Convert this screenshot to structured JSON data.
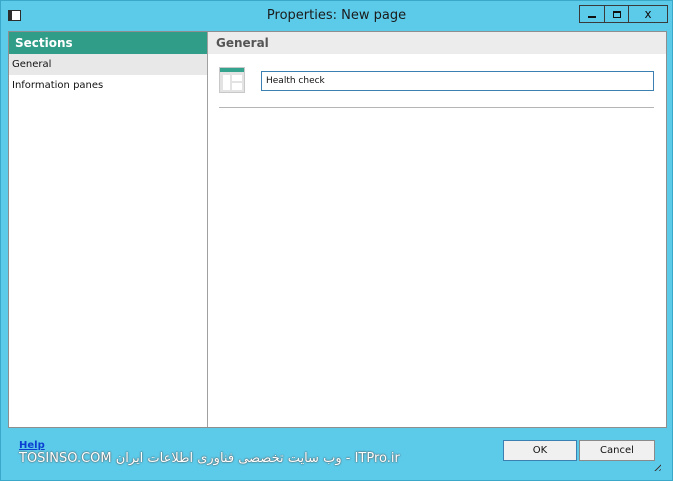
{
  "window": {
    "title": "Properties: New page",
    "controls": {
      "minimize_icon": "minimize-icon",
      "maximize_icon": "maximize-icon",
      "close_glyph": "x"
    }
  },
  "sidebar": {
    "header": "Sections",
    "items": [
      {
        "label": "General",
        "selected": true
      },
      {
        "label": "Information panes",
        "selected": false
      }
    ]
  },
  "main": {
    "header": "General",
    "page_icon": "page-layout-icon",
    "name_value": "Health check"
  },
  "footer": {
    "help_label": "Help",
    "ok_label": "OK",
    "cancel_label": "Cancel"
  },
  "watermark": {
    "text": "TOSINSO.COM  وب سایت تخصصی فناوری اطلاعات ایران - ITPro.ir"
  },
  "colors": {
    "titlebar": "#5ccbea",
    "sidebar_header": "#2f9d88",
    "link": "#0a3fd1"
  }
}
